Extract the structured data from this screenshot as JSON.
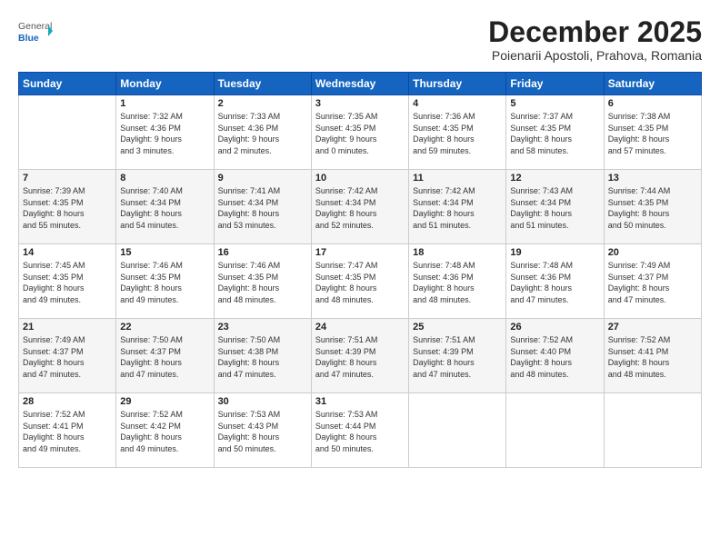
{
  "logo": {
    "general": "General",
    "blue": "Blue"
  },
  "header": {
    "month": "December 2025",
    "location": "Poienarii Apostoli, Prahova, Romania"
  },
  "days": [
    "Sunday",
    "Monday",
    "Tuesday",
    "Wednesday",
    "Thursday",
    "Friday",
    "Saturday"
  ],
  "weeks": [
    [
      {
        "day": "",
        "content": ""
      },
      {
        "day": "1",
        "content": "Sunrise: 7:32 AM\nSunset: 4:36 PM\nDaylight: 9 hours\nand 3 minutes."
      },
      {
        "day": "2",
        "content": "Sunrise: 7:33 AM\nSunset: 4:36 PM\nDaylight: 9 hours\nand 2 minutes."
      },
      {
        "day": "3",
        "content": "Sunrise: 7:35 AM\nSunset: 4:35 PM\nDaylight: 9 hours\nand 0 minutes."
      },
      {
        "day": "4",
        "content": "Sunrise: 7:36 AM\nSunset: 4:35 PM\nDaylight: 8 hours\nand 59 minutes."
      },
      {
        "day": "5",
        "content": "Sunrise: 7:37 AM\nSunset: 4:35 PM\nDaylight: 8 hours\nand 58 minutes."
      },
      {
        "day": "6",
        "content": "Sunrise: 7:38 AM\nSunset: 4:35 PM\nDaylight: 8 hours\nand 57 minutes."
      }
    ],
    [
      {
        "day": "7",
        "content": "Sunrise: 7:39 AM\nSunset: 4:35 PM\nDaylight: 8 hours\nand 55 minutes."
      },
      {
        "day": "8",
        "content": "Sunrise: 7:40 AM\nSunset: 4:34 PM\nDaylight: 8 hours\nand 54 minutes."
      },
      {
        "day": "9",
        "content": "Sunrise: 7:41 AM\nSunset: 4:34 PM\nDaylight: 8 hours\nand 53 minutes."
      },
      {
        "day": "10",
        "content": "Sunrise: 7:42 AM\nSunset: 4:34 PM\nDaylight: 8 hours\nand 52 minutes."
      },
      {
        "day": "11",
        "content": "Sunrise: 7:42 AM\nSunset: 4:34 PM\nDaylight: 8 hours\nand 51 minutes."
      },
      {
        "day": "12",
        "content": "Sunrise: 7:43 AM\nSunset: 4:34 PM\nDaylight: 8 hours\nand 51 minutes."
      },
      {
        "day": "13",
        "content": "Sunrise: 7:44 AM\nSunset: 4:35 PM\nDaylight: 8 hours\nand 50 minutes."
      }
    ],
    [
      {
        "day": "14",
        "content": "Sunrise: 7:45 AM\nSunset: 4:35 PM\nDaylight: 8 hours\nand 49 minutes."
      },
      {
        "day": "15",
        "content": "Sunrise: 7:46 AM\nSunset: 4:35 PM\nDaylight: 8 hours\nand 49 minutes."
      },
      {
        "day": "16",
        "content": "Sunrise: 7:46 AM\nSunset: 4:35 PM\nDaylight: 8 hours\nand 48 minutes."
      },
      {
        "day": "17",
        "content": "Sunrise: 7:47 AM\nSunset: 4:35 PM\nDaylight: 8 hours\nand 48 minutes."
      },
      {
        "day": "18",
        "content": "Sunrise: 7:48 AM\nSunset: 4:36 PM\nDaylight: 8 hours\nand 48 minutes."
      },
      {
        "day": "19",
        "content": "Sunrise: 7:48 AM\nSunset: 4:36 PM\nDaylight: 8 hours\nand 47 minutes."
      },
      {
        "day": "20",
        "content": "Sunrise: 7:49 AM\nSunset: 4:37 PM\nDaylight: 8 hours\nand 47 minutes."
      }
    ],
    [
      {
        "day": "21",
        "content": "Sunrise: 7:49 AM\nSunset: 4:37 PM\nDaylight: 8 hours\nand 47 minutes."
      },
      {
        "day": "22",
        "content": "Sunrise: 7:50 AM\nSunset: 4:37 PM\nDaylight: 8 hours\nand 47 minutes."
      },
      {
        "day": "23",
        "content": "Sunrise: 7:50 AM\nSunset: 4:38 PM\nDaylight: 8 hours\nand 47 minutes."
      },
      {
        "day": "24",
        "content": "Sunrise: 7:51 AM\nSunset: 4:39 PM\nDaylight: 8 hours\nand 47 minutes."
      },
      {
        "day": "25",
        "content": "Sunrise: 7:51 AM\nSunset: 4:39 PM\nDaylight: 8 hours\nand 47 minutes."
      },
      {
        "day": "26",
        "content": "Sunrise: 7:52 AM\nSunset: 4:40 PM\nDaylight: 8 hours\nand 48 minutes."
      },
      {
        "day": "27",
        "content": "Sunrise: 7:52 AM\nSunset: 4:41 PM\nDaylight: 8 hours\nand 48 minutes."
      }
    ],
    [
      {
        "day": "28",
        "content": "Sunrise: 7:52 AM\nSunset: 4:41 PM\nDaylight: 8 hours\nand 49 minutes."
      },
      {
        "day": "29",
        "content": "Sunrise: 7:52 AM\nSunset: 4:42 PM\nDaylight: 8 hours\nand 49 minutes."
      },
      {
        "day": "30",
        "content": "Sunrise: 7:53 AM\nSunset: 4:43 PM\nDaylight: 8 hours\nand 50 minutes."
      },
      {
        "day": "31",
        "content": "Sunrise: 7:53 AM\nSunset: 4:44 PM\nDaylight: 8 hours\nand 50 minutes."
      },
      {
        "day": "",
        "content": ""
      },
      {
        "day": "",
        "content": ""
      },
      {
        "day": "",
        "content": ""
      }
    ]
  ]
}
